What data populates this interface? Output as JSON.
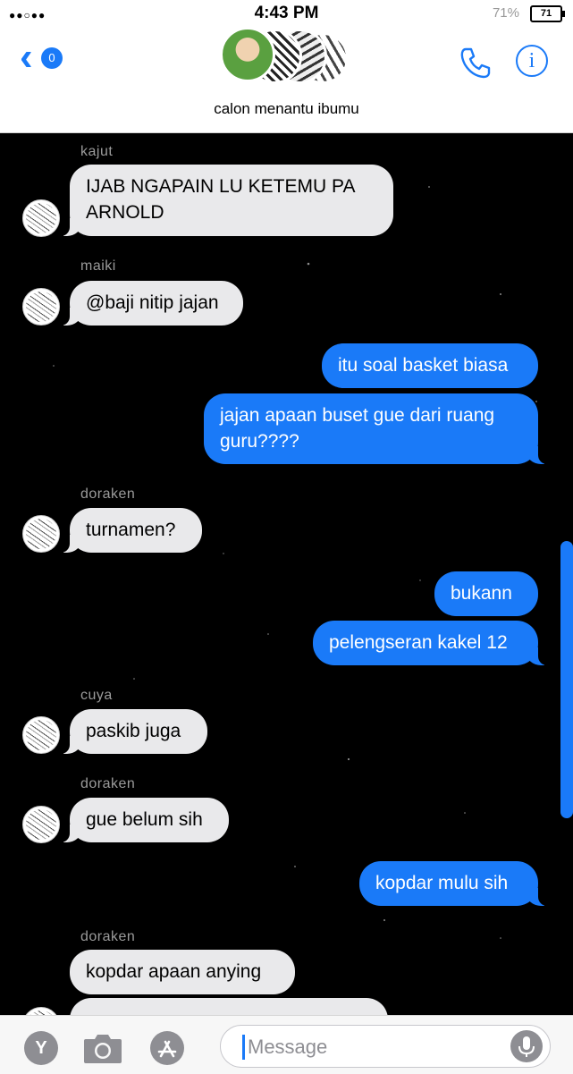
{
  "status_bar": {
    "time": "4:43 PM",
    "battery_percent": "71%",
    "battery_icon_text": "71"
  },
  "header": {
    "back_badge_count": "0",
    "chat_title": "calon menantu ibumu"
  },
  "messages": [
    {
      "sender": "kajut",
      "direction": "in",
      "text": "IJAB NGAPAIN LU KETEMU PA ARNOLD"
    },
    {
      "sender": "maiki",
      "direction": "in",
      "text": "@baji nitip jajan"
    },
    {
      "direction": "out",
      "text": "itu soal basket biasa"
    },
    {
      "direction": "out",
      "text": "jajan apaan buset gue dari ruang guru????"
    },
    {
      "sender": "doraken",
      "direction": "in",
      "text": "turnamen?"
    },
    {
      "direction": "out",
      "text": "bukann"
    },
    {
      "direction": "out",
      "text": "pelengseran kakel 12"
    },
    {
      "sender": "cuya",
      "direction": "in",
      "text": "paskib juga"
    },
    {
      "sender": "doraken",
      "direction": "in",
      "text": "gue belum sih"
    },
    {
      "direction": "out",
      "text": "kopdar mulu sih"
    },
    {
      "sender": "doraken",
      "direction": "in",
      "text": "kopdar apaan anying"
    }
  ],
  "composer": {
    "apps_button_letter": "Y",
    "placeholder": "Message"
  },
  "colors": {
    "accent": "#1a7af8",
    "incoming_bubble": "#e9e9eb",
    "chat_background": "#000000"
  },
  "icons": [
    "back-chevron-icon",
    "phone-icon",
    "info-icon",
    "camera-icon",
    "app-store-icon",
    "microphone-icon"
  ]
}
